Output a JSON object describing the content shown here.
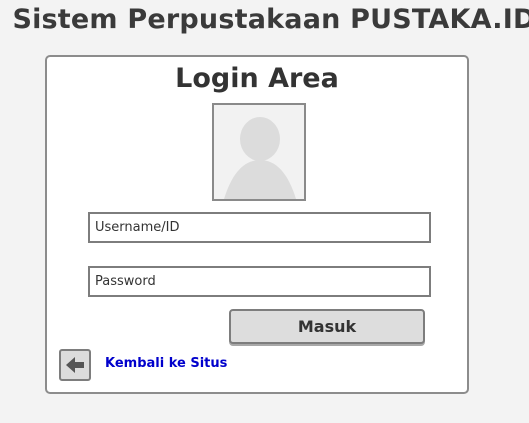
{
  "header": {
    "title": "Sistem Perpustakaan PUSTAKA.ID"
  },
  "login_panel": {
    "title": "Login Area",
    "avatar_icon": "user-placeholder-icon",
    "username_field": {
      "value": "",
      "placeholder": "Username/ID"
    },
    "password_field": {
      "value": "",
      "placeholder": "Password"
    },
    "submit_label": "Masuk",
    "back_icon": "arrow-left-icon",
    "back_link_label": "Kembali ke Situs"
  },
  "colors": {
    "page_background": "#f3f3f3",
    "panel_background": "#ffffff",
    "border": "#8c8c8c",
    "button_background": "#dddddd",
    "link": "#0000cc",
    "text": "#333333"
  }
}
